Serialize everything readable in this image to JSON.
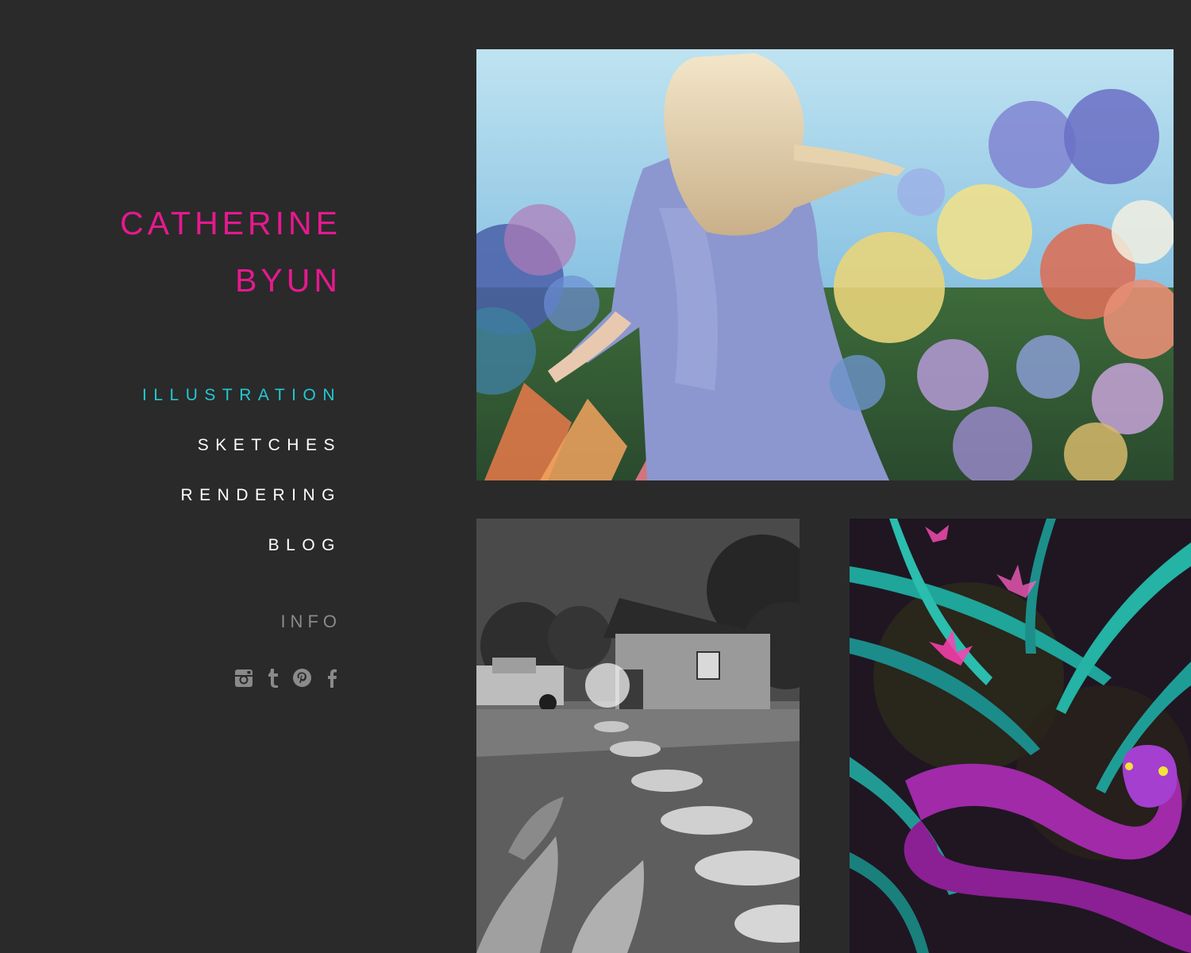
{
  "site": {
    "title_line1": "CATHERINE",
    "title_line2": "BYUN",
    "title_color": "#e6198f"
  },
  "nav": {
    "items": [
      {
        "label": "ILLUSTRATION",
        "active": true
      },
      {
        "label": "SKETCHES",
        "active": false
      },
      {
        "label": "RENDERING",
        "active": false
      },
      {
        "label": "BLOG",
        "active": false
      }
    ],
    "active_color": "#22c9d2"
  },
  "info_label": "INFO",
  "social_icons": [
    "instagram-icon",
    "tumblr-icon",
    "pinterest-icon",
    "facebook-icon"
  ],
  "gallery": [
    {
      "subject": "girl-in-flower-garden-illustration"
    },
    {
      "subject": "black-and-white-house-with-truck-illustration"
    },
    {
      "subject": "snake-in-jungle-leaves-illustration"
    }
  ],
  "colors": {
    "background": "#2a2a2a",
    "nav_text": "#ffffff",
    "info_text": "#8a8a8a"
  }
}
